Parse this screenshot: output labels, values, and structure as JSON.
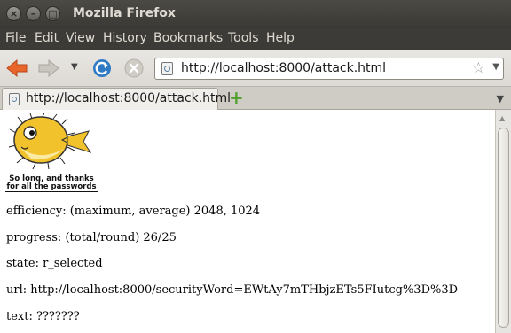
{
  "window": {
    "title": "Mozilla Firefox",
    "controls": [
      "×",
      "–",
      "□"
    ]
  },
  "menubar": {
    "items": [
      "File",
      "Edit",
      "View",
      "History",
      "Bookmarks",
      "Tools",
      "Help"
    ]
  },
  "toolbar": {
    "back_icon": "back-arrow-icon",
    "forward_icon": "forward-arrow-icon",
    "history_dropdown": "▼",
    "reload_icon": "reload-icon",
    "stop_icon": "stop-icon",
    "url": "http://localhost:8000/attack.html",
    "bookmark_star": "☆",
    "url_dropdown": "▼"
  },
  "tabs": [
    {
      "label": "http://localhost:8000/attack.html",
      "active": true
    }
  ],
  "tabbar": {
    "new_tab": "+",
    "list_tabs": "▼"
  },
  "page": {
    "logo_caption_line1": "So long, and thanks",
    "logo_caption_line2": "for all the passwords",
    "lines": [
      "efficiency: (maximum, average) 2048, 1024",
      "progress: (total/round) 26/25",
      "state: r_selected",
      "url: http://localhost:8000/securityWord=EWtAy7mTHbjzETs5FIutcg%3D%3D",
      "text: ???????"
    ]
  },
  "colors": {
    "titlebar": "#3c3b37",
    "title_text": "#dfdbd2",
    "back_arrow": "#e8652b",
    "reload": "#2f7ac5",
    "new_tab_plus": "#4fa12b",
    "logo_fish": "#f2c22c"
  }
}
